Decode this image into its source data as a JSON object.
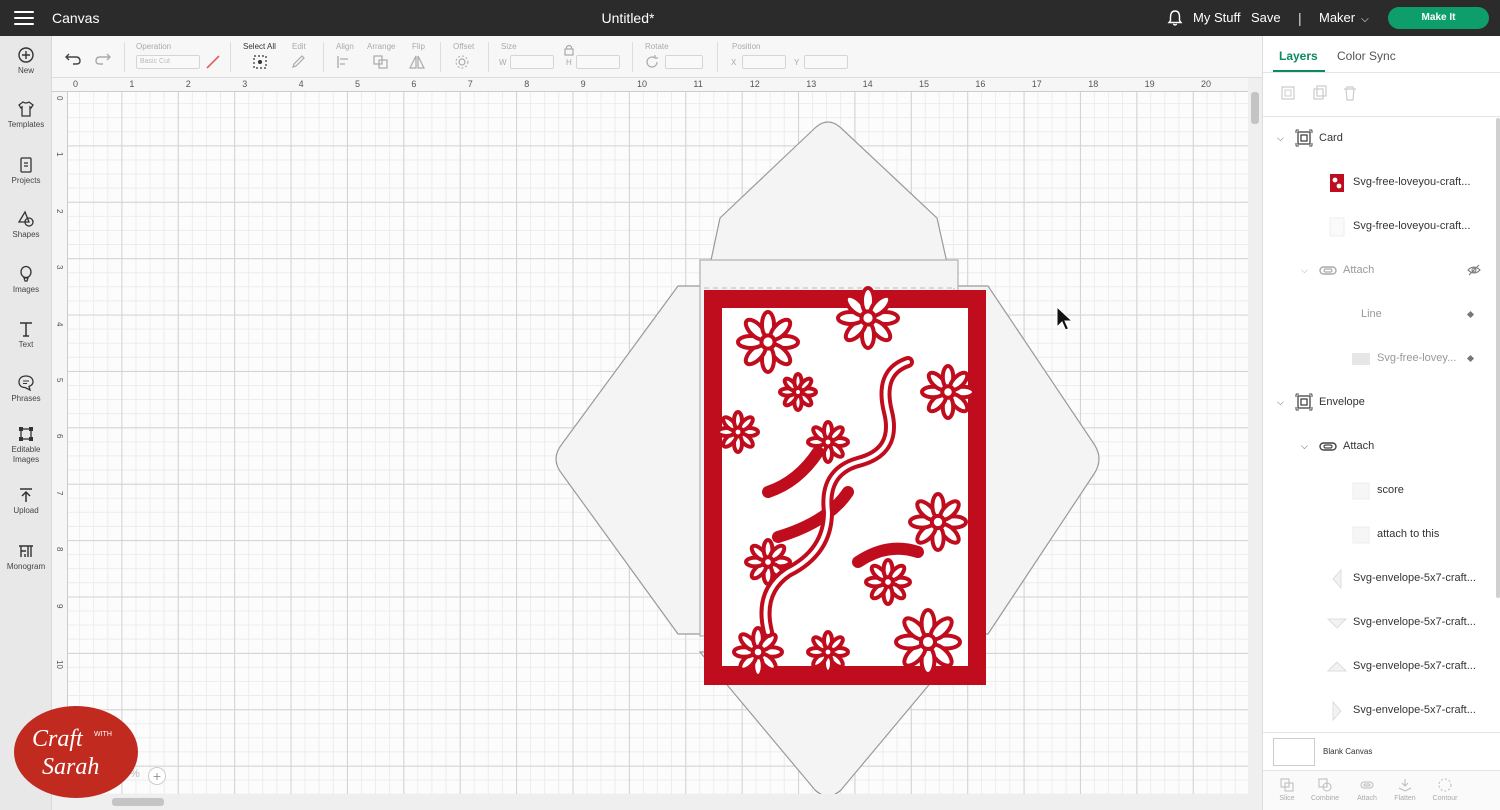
{
  "header": {
    "app_title": "Canvas",
    "document_title": "Untitled*",
    "my_stuff": "My Stuff",
    "save": "Save",
    "divider": "|",
    "machine": "Maker",
    "make_it": "Make It"
  },
  "sidebar": {
    "items": [
      {
        "label": "New",
        "icon": "plus-circle-icon"
      },
      {
        "label": "Templates",
        "icon": "shirt-icon"
      },
      {
        "label": "Projects",
        "icon": "projects-icon"
      },
      {
        "label": "Shapes",
        "icon": "shapes-icon"
      },
      {
        "label": "Images",
        "icon": "balloon-icon"
      },
      {
        "label": "Text",
        "icon": "text-icon"
      },
      {
        "label": "Phrases",
        "icon": "speech-bubble-icon"
      },
      {
        "label": "Editable Images",
        "icon": "editable-images-icon"
      },
      {
        "label": "Upload",
        "icon": "upload-icon"
      },
      {
        "label": "Monogram",
        "icon": "monogram-icon"
      }
    ]
  },
  "toolbar": {
    "operation_label": "Operation",
    "operation_value": "Basic Cut",
    "select_all": "Select All",
    "edit": "Edit",
    "align": "Align",
    "arrange": "Arrange",
    "flip": "Flip",
    "offset": "Offset",
    "size": "Size",
    "size_w": "W",
    "size_h": "H",
    "rotate": "Rotate",
    "position": "Position",
    "pos_x": "X",
    "pos_y": "Y"
  },
  "rulers": {
    "top": [
      "0",
      "1",
      "2",
      "3",
      "4",
      "5",
      "6",
      "7",
      "8",
      "9",
      "10",
      "11",
      "12",
      "13",
      "14",
      "15",
      "16",
      "17",
      "18",
      "19",
      "20"
    ],
    "left": [
      "0",
      "1",
      "2",
      "3",
      "4",
      "5",
      "6",
      "7",
      "8",
      "9",
      "10"
    ]
  },
  "canvas": {
    "zoom": "%",
    "card_color": "#c00d1e",
    "envelope_color": "#f4f4f4"
  },
  "logo": {
    "line1": "Craft",
    "with": "WITH",
    "line2": "Sarah",
    "color": "#c02a1f"
  },
  "panel": {
    "tabs": [
      "Layers",
      "Color Sync"
    ],
    "layers": [
      {
        "name": "Card",
        "type": "group",
        "indent": 0
      },
      {
        "name": "Svg-free-loveyou-craft...",
        "type": "layer-red",
        "indent": 2
      },
      {
        "name": "Svg-free-loveyou-craft...",
        "type": "layer-white",
        "indent": 2
      },
      {
        "name": "Attach",
        "type": "attach-hidden",
        "indent": 1
      },
      {
        "name": "Line",
        "type": "line-hidden",
        "indent": 3
      },
      {
        "name": "Svg-free-lovey...",
        "type": "layer-hidden",
        "indent": 3
      },
      {
        "name": "Envelope",
        "type": "group",
        "indent": 0
      },
      {
        "name": "Attach",
        "type": "attach",
        "indent": 1
      },
      {
        "name": "score",
        "type": "score",
        "indent": 3
      },
      {
        "name": "attach to this",
        "type": "blank",
        "indent": 3
      },
      {
        "name": "Svg-envelope-5x7-craft...",
        "type": "env-left",
        "indent": 2
      },
      {
        "name": "Svg-envelope-5x7-craft...",
        "type": "env-top",
        "indent": 2
      },
      {
        "name": "Svg-envelope-5x7-craft...",
        "type": "env-bottom",
        "indent": 2
      },
      {
        "name": "Svg-envelope-5x7-craft...",
        "type": "env-right",
        "indent": 2
      }
    ],
    "blank_canvas": "Blank Canvas",
    "bottom_tools": [
      "Slice",
      "Combine",
      "Attach",
      "Flatten",
      "Contour"
    ]
  }
}
